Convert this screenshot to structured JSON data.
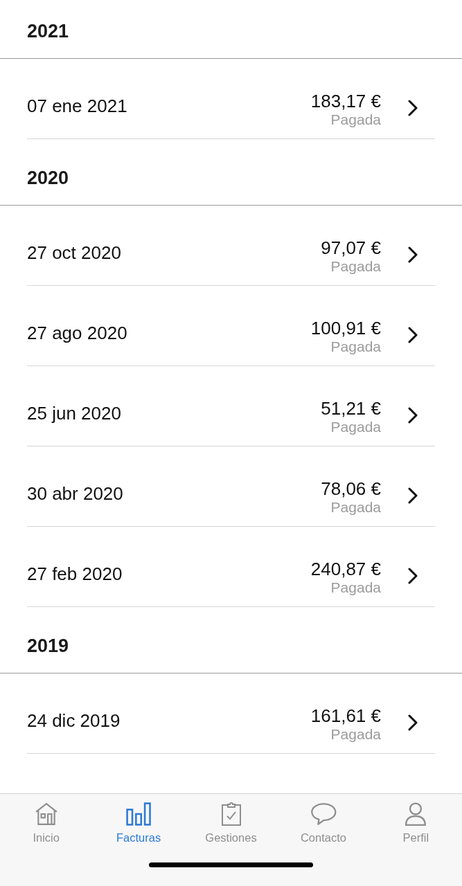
{
  "sections": [
    {
      "year": "2021",
      "invoices": [
        {
          "date": "07 ene 2021",
          "amount": "183,17 €",
          "status": "Pagada"
        }
      ]
    },
    {
      "year": "2020",
      "invoices": [
        {
          "date": "27 oct 2020",
          "amount": "97,07 €",
          "status": "Pagada"
        },
        {
          "date": "27 ago 2020",
          "amount": "100,91 €",
          "status": "Pagada"
        },
        {
          "date": "25 jun 2020",
          "amount": "51,21 €",
          "status": "Pagada"
        },
        {
          "date": "30 abr 2020",
          "amount": "78,06 €",
          "status": "Pagada"
        },
        {
          "date": "27 feb 2020",
          "amount": "240,87 €",
          "status": "Pagada"
        }
      ]
    },
    {
      "year": "2019",
      "invoices": [
        {
          "date": "24 dic 2019",
          "amount": "161,61 €",
          "status": "Pagada"
        }
      ]
    }
  ],
  "tabs": [
    {
      "label": "Inicio",
      "selected": false
    },
    {
      "label": "Facturas",
      "selected": true
    },
    {
      "label": "Gestiones",
      "selected": false
    },
    {
      "label": "Contacto",
      "selected": false
    },
    {
      "label": "Perfil",
      "selected": false
    }
  ]
}
